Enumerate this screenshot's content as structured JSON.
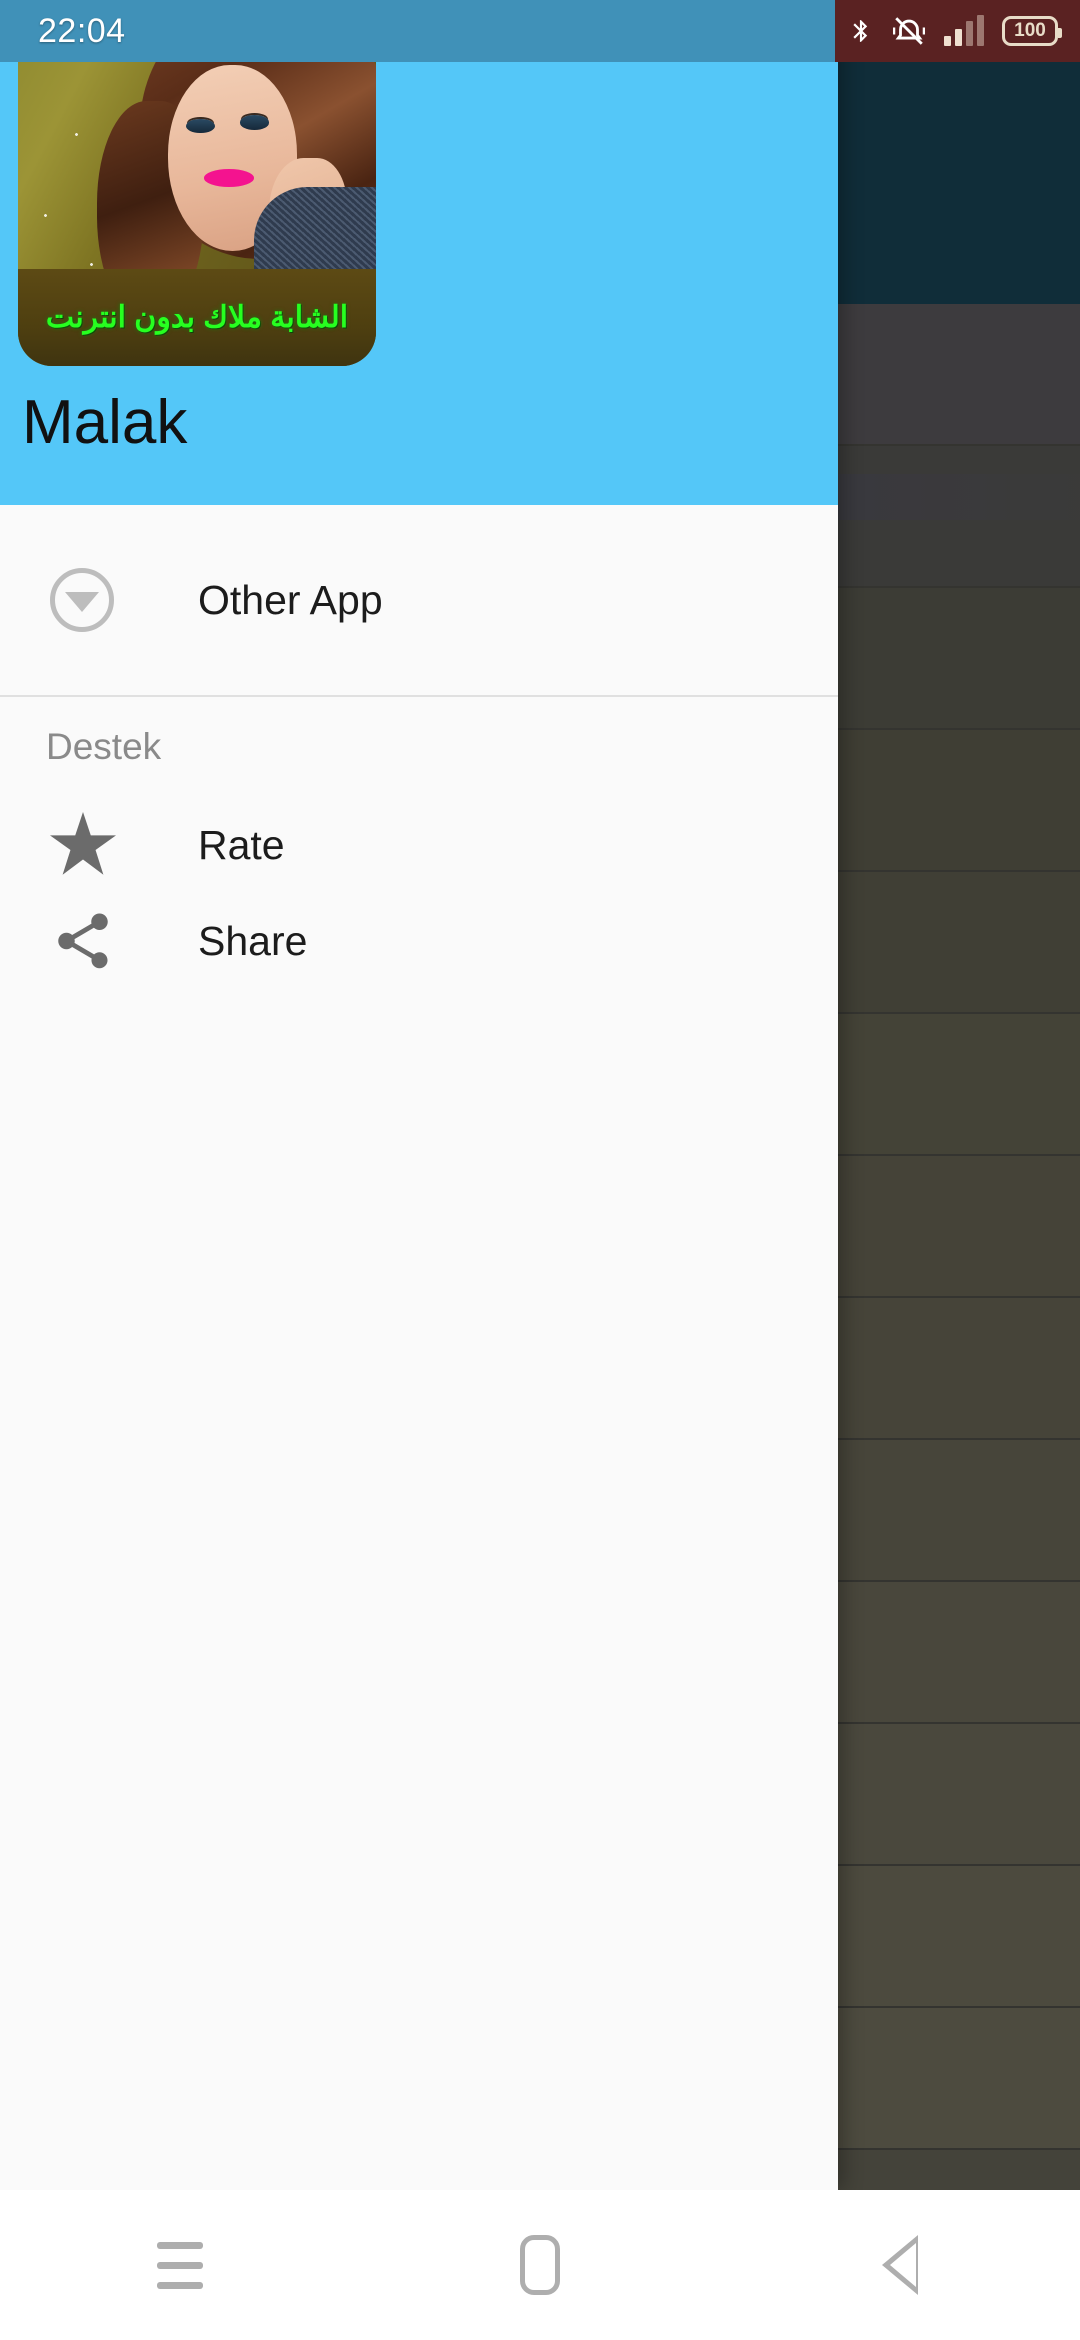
{
  "status_bar": {
    "clock": "22:04",
    "battery_level": "100",
    "icons": [
      "bluetooth-icon",
      "vibrate-mute-icon",
      "signal-bars-icon",
      "battery-icon"
    ],
    "left_bg_color": "#4091b8",
    "right_bg_color": "#5a2222"
  },
  "drawer": {
    "header": {
      "background_color": "#54c7f8",
      "app_title": "Malak",
      "app_icon_caption": "الشابة ملاك بدون انترنت",
      "app_icon_caption_color": "#27ff20"
    },
    "items": [
      {
        "label": "Other App",
        "icon": "download-circle-icon"
      }
    ],
    "section": {
      "title": "Destek",
      "items": [
        {
          "label": "Rate",
          "icon": "star-icon"
        },
        {
          "label": "Share",
          "icon": "share-icon"
        }
      ]
    },
    "background_color": "#fafafa"
  },
  "background_app": {
    "appbar_color": "#1e5368",
    "scrim_color": "rgba(0,0,0,0.45)",
    "row_count": 13
  },
  "navigation_bar": {
    "buttons": [
      {
        "name": "recents",
        "icon": "hamburger-icon"
      },
      {
        "name": "home",
        "icon": "home-square-icon"
      },
      {
        "name": "back",
        "icon": "back-triangle-icon"
      }
    ],
    "background_color": "#ffffff"
  }
}
